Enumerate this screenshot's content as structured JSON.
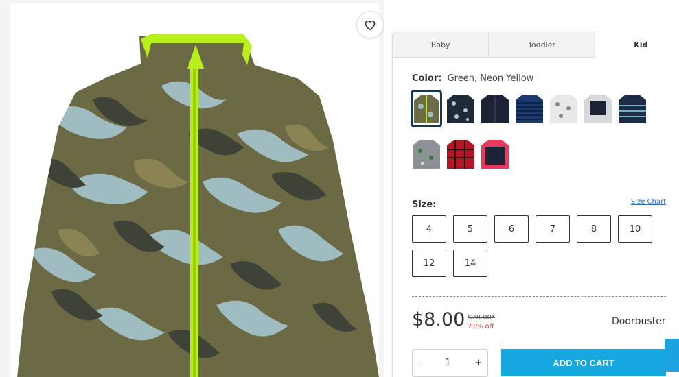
{
  "product": {
    "favorite_icon": "heart-icon"
  },
  "tabs": [
    {
      "label": "Baby"
    },
    {
      "label": "Toddler"
    },
    {
      "label": "Kid"
    }
  ],
  "color": {
    "label": "Color:",
    "value": "Green, Neon Yellow",
    "swatches": [
      {
        "name": "green-camo",
        "selected": true
      },
      {
        "name": "dino-print"
      },
      {
        "name": "navy"
      },
      {
        "name": "blue-stripe"
      },
      {
        "name": "white-print"
      },
      {
        "name": "navy-grey"
      },
      {
        "name": "fair-isle"
      },
      {
        "name": "grey-print"
      },
      {
        "name": "red-plaid"
      },
      {
        "name": "navy-pink"
      }
    ]
  },
  "size": {
    "label": "Size:",
    "chart_link": "Size Chart",
    "options": [
      "4",
      "5",
      "6",
      "7",
      "8",
      "10",
      "12",
      "14"
    ]
  },
  "pricing": {
    "price": "$8.00",
    "was_price": "$28.00*",
    "discount": "71% off",
    "badge": "Doorbuster"
  },
  "cart": {
    "qty_minus": "-",
    "qty_value": "1",
    "qty_plus": "+",
    "add_label": "ADD TO CART"
  },
  "colors": {
    "accent": "#18a8e0",
    "selected_swatch": "#123a57",
    "discount": "#e03a3a",
    "link": "#2f72c4"
  }
}
